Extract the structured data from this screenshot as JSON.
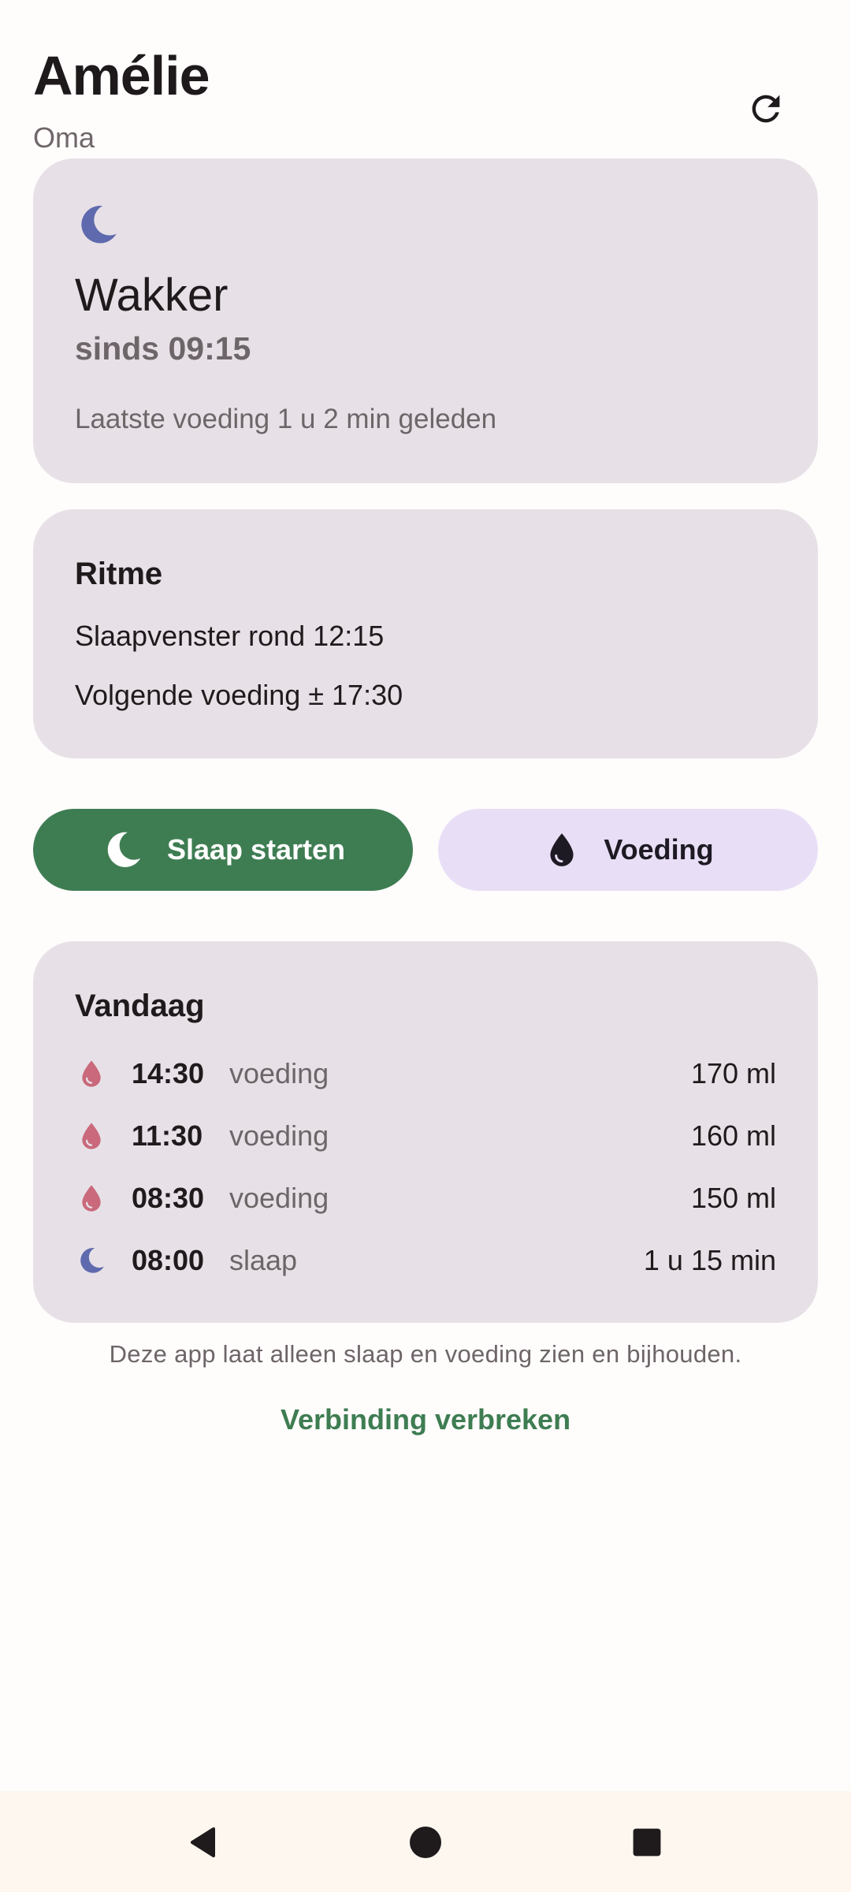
{
  "header": {
    "child_name": "Amélie",
    "caregiver_role": "Oma",
    "refresh_icon": "refresh-icon"
  },
  "status": {
    "icon": "moon-icon",
    "state": "Wakker",
    "since": "sinds 09:15",
    "last_feeding": "Laatste voeding 1 u 2 min geleden"
  },
  "rhythm": {
    "title": "Ritme",
    "sleep_window": "Slaapvenster rond 12:15",
    "next_feeding": "Volgende voeding ± 17:30"
  },
  "actions": {
    "sleep_label": "Slaap starten",
    "sleep_icon": "moon-icon",
    "feed_label": "Voeding",
    "feed_icon": "drop-icon"
  },
  "today": {
    "title": "Vandaag",
    "entries": [
      {
        "icon": "drop-icon",
        "time": "14:30",
        "type": "voeding",
        "amount": "170 ml"
      },
      {
        "icon": "drop-icon",
        "time": "11:30",
        "type": "voeding",
        "amount": "160 ml"
      },
      {
        "icon": "drop-icon",
        "time": "08:30",
        "type": "voeding",
        "amount": "150 ml"
      },
      {
        "icon": "moon-icon",
        "time": "08:00",
        "type": "slaap",
        "amount": "1 u 15 min"
      }
    ]
  },
  "footer": {
    "disclaimer": "Deze app laat alleen slaap en voeding zien en bijhouden.",
    "disconnect_label": "Verbinding verbreken"
  },
  "colors": {
    "accent_green": "#3e7d52",
    "card_bg": "#e7e1e7",
    "moon_blue": "#5f6aae",
    "drop_pink": "#c9697b",
    "feed_button_bg": "#e8dff6"
  }
}
